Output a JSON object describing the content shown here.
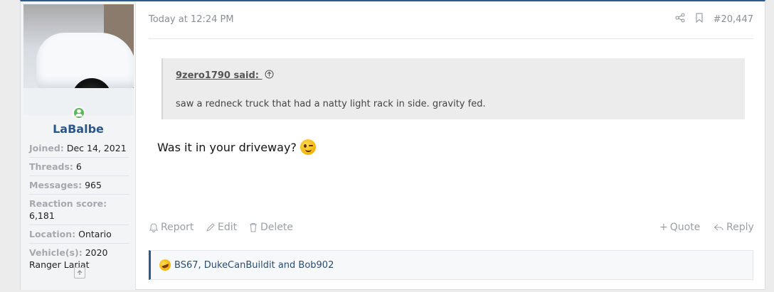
{
  "user": {
    "username": "LaBalbe",
    "stats": [
      {
        "label": "Joined:",
        "value": "Dec 14, 2021"
      },
      {
        "label": "Threads:",
        "value": "6"
      },
      {
        "label": "Messages:",
        "value": "965"
      },
      {
        "label": "Reaction score:",
        "value": "6,181"
      },
      {
        "label": "Location:",
        "value": "Ontario"
      },
      {
        "label": "Vehicle(s):",
        "value": "2020 Ranger Lariat"
      }
    ]
  },
  "post": {
    "timestamp": "Today at 12:24 PM",
    "number": "#20,447",
    "quote": {
      "author": "9zero1790 said:",
      "text": "saw a redneck truck that had a natty light rack in side. gravity fed."
    },
    "message": "Was it in your driveway?",
    "message_emoji": "winking-tongue-emoji",
    "actions": {
      "report": "Report",
      "edit": "Edit",
      "delete": "Delete",
      "quote": "Quote",
      "reply": "Reply"
    },
    "reactions": {
      "emoji": "rofl-emoji",
      "text": "BS67, DukeCanBuildit and Bob902"
    }
  },
  "colors": {
    "accent": "#2c5a8c",
    "username": "#2a5689",
    "online": "#5cb85c"
  }
}
